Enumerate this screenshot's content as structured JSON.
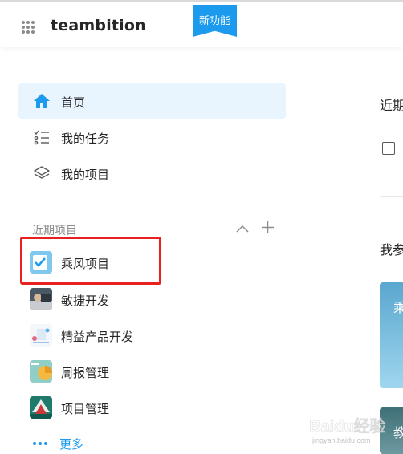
{
  "header": {
    "logo": "teambition",
    "new_feature_badge": "新功能",
    "apps_icon": "apps-grid-icon"
  },
  "sidebar": {
    "nav": [
      {
        "label": "首页",
        "icon": "home-icon",
        "active": true
      },
      {
        "label": "我的任务",
        "icon": "task-list-icon",
        "active": false
      },
      {
        "label": "我的项目",
        "icon": "layers-icon",
        "active": false
      }
    ],
    "recent_title": "近期项目",
    "recent_projects": [
      {
        "label": "乘风项目",
        "icon": "checkbox-thumbnail"
      },
      {
        "label": "敏捷开发",
        "icon": "photo-thumbnail"
      },
      {
        "label": "精益产品开发",
        "icon": "illustration-thumbnail"
      },
      {
        "label": "周报管理",
        "icon": "chart-thumbnail"
      },
      {
        "label": "项目管理",
        "icon": "tree-thumbnail"
      }
    ],
    "more_label": "更多"
  },
  "main": {
    "recent_heading": "近期",
    "participating_heading": "我参",
    "card_titles": [
      "乘",
      "教"
    ]
  },
  "colors": {
    "accent": "#1b9aee",
    "active_nav_bg": "#e8f4fe",
    "highlight": "#e8201f"
  },
  "watermark": {
    "text": "Baidu经验",
    "sub": "jingyan.baidu.com"
  }
}
